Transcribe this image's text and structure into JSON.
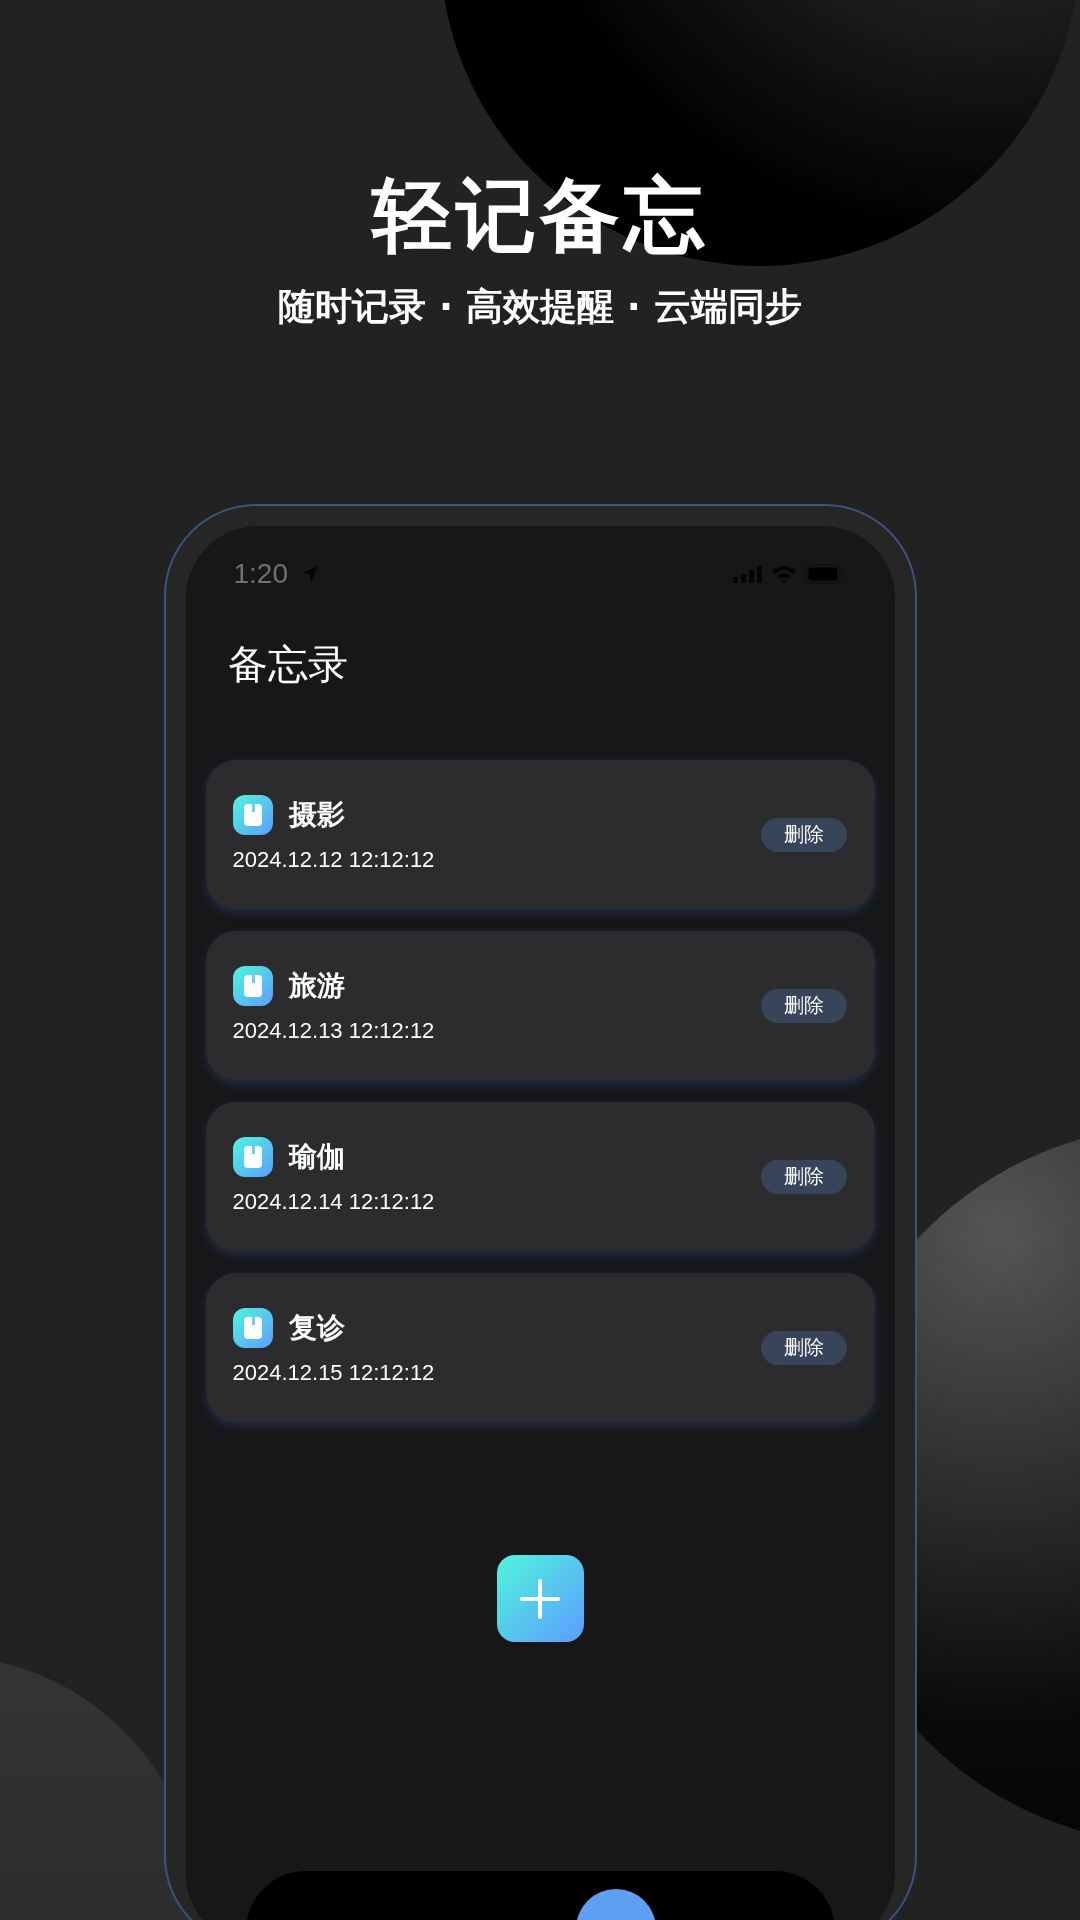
{
  "headline": "轻记备忘",
  "tagline": "随时记录 · 高效提醒 · 云端同步",
  "phone": {
    "status_bar": {
      "time": "1:20"
    },
    "title": "备忘录",
    "notes": [
      {
        "title": "摄影",
        "date": "2024.12.12 12:12:12",
        "action": "删除"
      },
      {
        "title": "旅游",
        "date": "2024.12.13 12:12:12",
        "action": "删除"
      },
      {
        "title": "瑜伽",
        "date": "2024.12.14 12:12:12",
        "action": "删除"
      },
      {
        "title": "复诊",
        "date": "2024.12.15 12:12:12",
        "action": "删除"
      }
    ]
  }
}
